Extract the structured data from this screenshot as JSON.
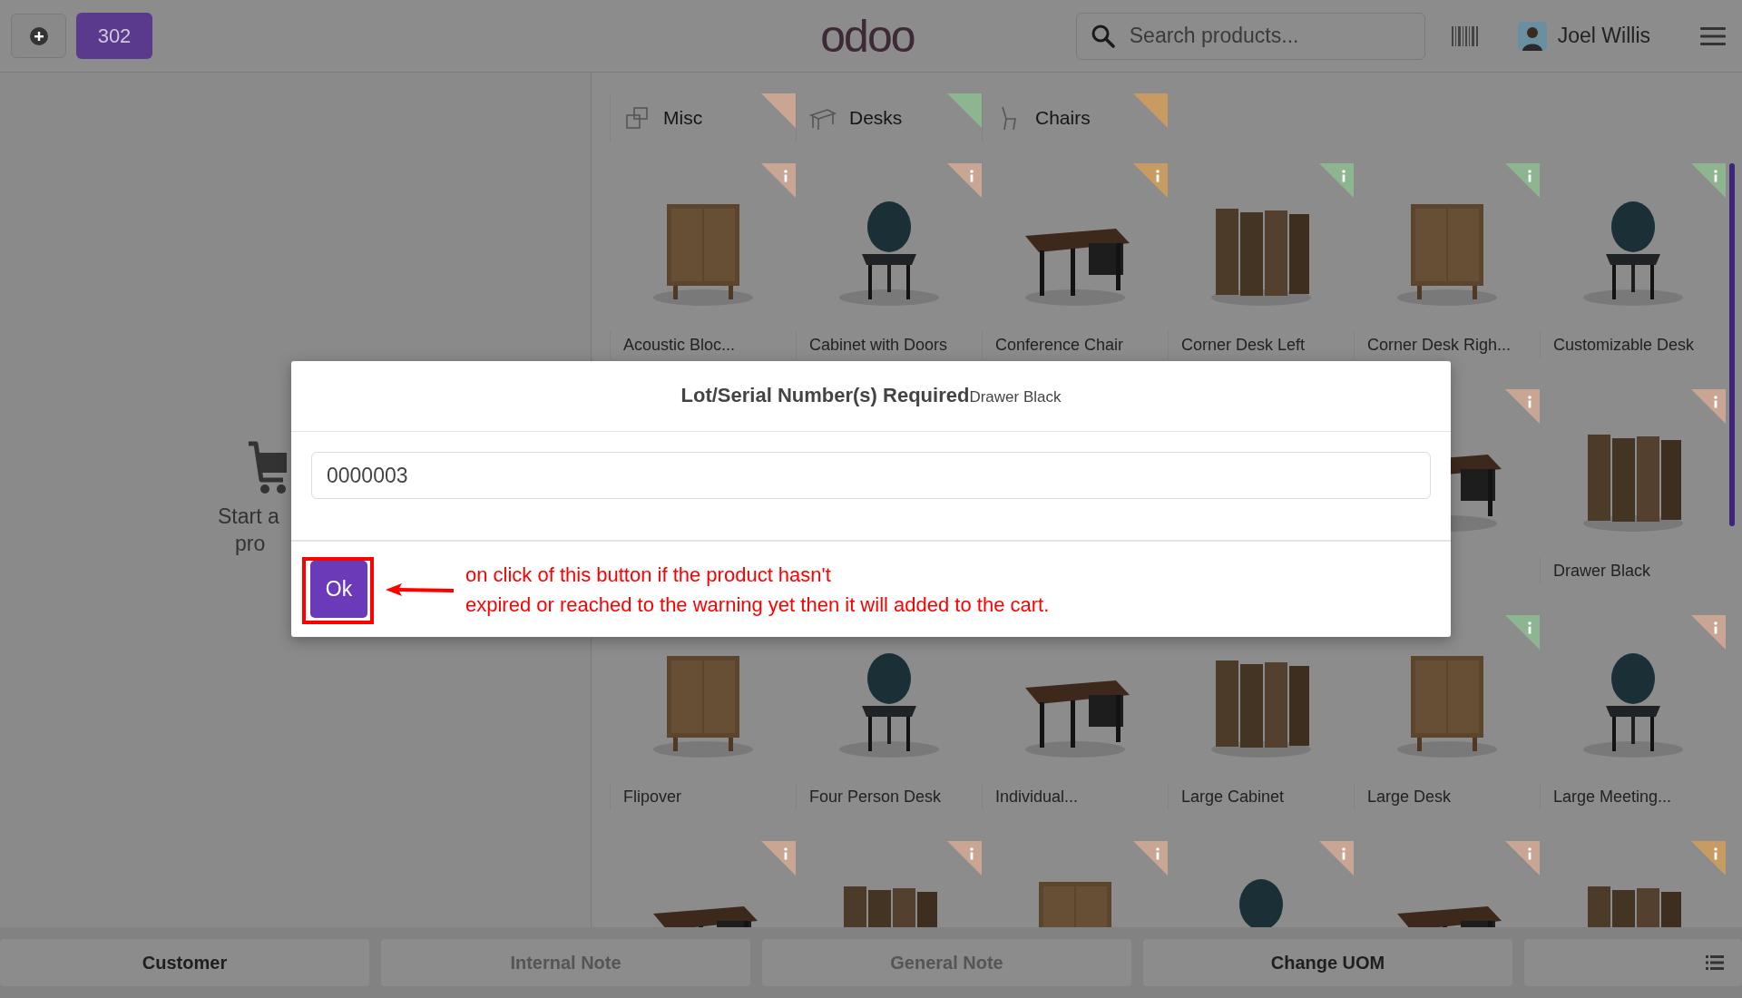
{
  "top_bar": {
    "order_button": "302",
    "logo": "odoo",
    "search": {
      "placeholder": "Search products..."
    },
    "user": {
      "name": "Joel Willis"
    }
  },
  "left_pane": {
    "empty_cart_lines": [
      "Start a",
      "pro"
    ]
  },
  "categories": [
    {
      "label": "Misc",
      "color": "#c9a594"
    },
    {
      "label": "Desks",
      "color": "#8db58f"
    },
    {
      "label": "Chairs",
      "color": "#c89b63"
    }
  ],
  "product_rows": [
    [
      {
        "name": "Acoustic Bloc...",
        "color": "#c9a594"
      },
      {
        "name": "Cabinet with Doors",
        "color": "#c9a594"
      },
      {
        "name": "Conference Chair",
        "color": "#c89b63"
      },
      {
        "name": "Corner Desk Left",
        "color": "#8db58f"
      },
      {
        "name": "Corner Desk Righ...",
        "color": "#8db58f"
      },
      {
        "name": "Customizable Desk",
        "color": "#8db58f"
      }
    ],
    [
      {
        "color": "#c9a594"
      },
      {
        "name": "Drawer Black",
        "color": "#c9a594"
      }
    ],
    [
      {
        "name": "Flipover"
      },
      {
        "name": "Four Person Desk"
      },
      {
        "name": "Individual..."
      },
      {
        "name": "Large Cabinet"
      },
      {
        "name": "Large Desk",
        "color": "#8db58f"
      },
      {
        "name": "Large Meeting...",
        "color": "#c9a594"
      }
    ],
    [
      {
        "color": "#c9a594"
      },
      {
        "color": "#c9a594"
      },
      {
        "color": "#c9a594"
      },
      {
        "color": "#c9a594"
      },
      {
        "color": "#c9a594"
      },
      {
        "color": "#c89b63"
      }
    ]
  ],
  "bottom_bar": {
    "buttons": [
      {
        "label": "Customer",
        "disabled": false
      },
      {
        "label": "Internal Note",
        "disabled": true
      },
      {
        "label": "General Note",
        "disabled": true
      },
      {
        "label": "Change UOM",
        "disabled": false
      }
    ]
  },
  "dialog": {
    "title": "Lot/Serial Number(s) Required",
    "product": "Drawer Black",
    "lot_value": "0000003",
    "ok_button": "Ok"
  },
  "annotation": {
    "text": "on click of this button if the product hasn't\nexpired or reached to the warning yet then it will added to the cart."
  }
}
